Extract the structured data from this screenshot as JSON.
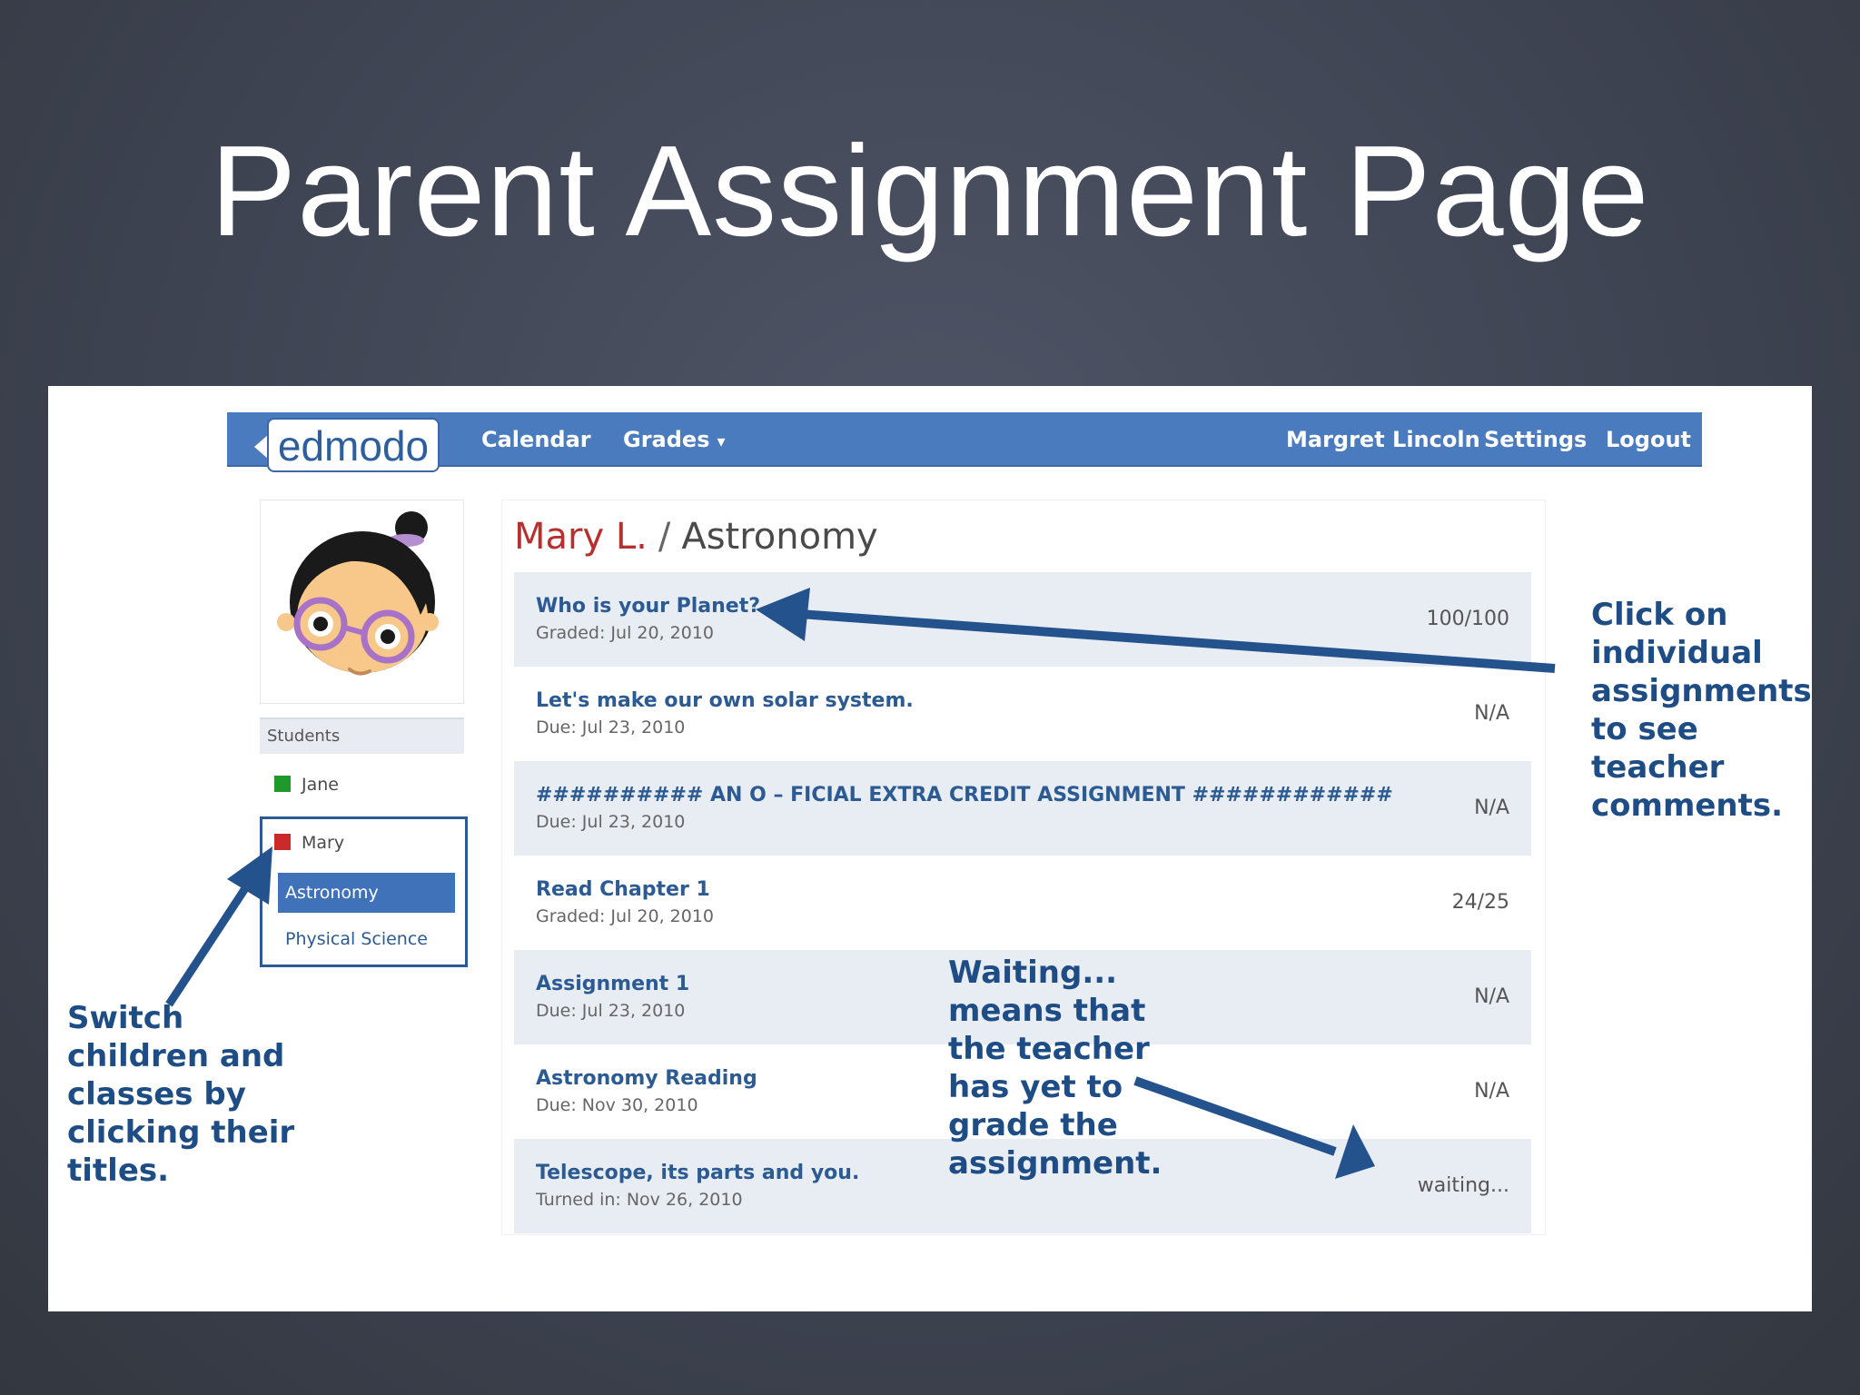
{
  "slide": {
    "title": "Parent Assignment Page"
  },
  "header": {
    "logo": "edmodo",
    "nav_left": [
      {
        "label": "Calendar"
      },
      {
        "label": "Grades",
        "caret": "▾"
      }
    ],
    "nav_right": [
      {
        "label": "Margret Lincoln"
      },
      {
        "label": "Settings"
      },
      {
        "label": "Logout"
      }
    ]
  },
  "sidebar": {
    "students_header": "Students",
    "students": [
      {
        "name": "Jane",
        "color": "#1f9a2a"
      },
      {
        "name": "Mary",
        "color": "#cc2a2a",
        "classes": [
          "Astronomy",
          "Physical Science"
        ],
        "selected_class": "Astronomy"
      }
    ]
  },
  "main": {
    "breadcrumb": {
      "student": "Mary L.",
      "separator": "/",
      "class": "Astronomy"
    },
    "assignments": [
      {
        "title": "Who is your Planet?",
        "date": "Graded: Jul 20, 2010",
        "score": "100/100"
      },
      {
        "title": "Let's make our own solar system.",
        "date": "Due: Jul 23, 2010",
        "score": "N/A"
      },
      {
        "title": "########## AN O – FICIAL EXTRA CREDIT ASSIGNMENT ############",
        "date": "Due: Jul 23, 2010",
        "score": "N/A"
      },
      {
        "title": "Read Chapter 1",
        "date": "Graded: Jul 20, 2010",
        "score": "24/25"
      },
      {
        "title": "Assignment 1",
        "date": "Due: Jul 23, 2010",
        "score": "N/A"
      },
      {
        "title": "Astronomy Reading",
        "date": "Due: Nov 30, 2010",
        "score": "N/A"
      },
      {
        "title": "Telescope, its parts and you.",
        "date": "Turned in: Nov 26, 2010",
        "score": "waiting..."
      }
    ]
  },
  "annotations": {
    "click_note": [
      "Click on",
      "individual",
      "assignments",
      "to see",
      "teacher",
      "comments."
    ],
    "switch_note": [
      "Switch",
      "children and",
      "classes by",
      "clicking their",
      "titles."
    ],
    "waiting_note": [
      "Waiting...",
      "means that",
      "the teacher",
      "has yet to",
      "grade the",
      "assignment."
    ]
  },
  "colors": {
    "topbar": "#4b7bbf",
    "link_blue": "#2c5a92",
    "annotation_blue": "#1e4c85",
    "student_red": "#b5302f"
  }
}
